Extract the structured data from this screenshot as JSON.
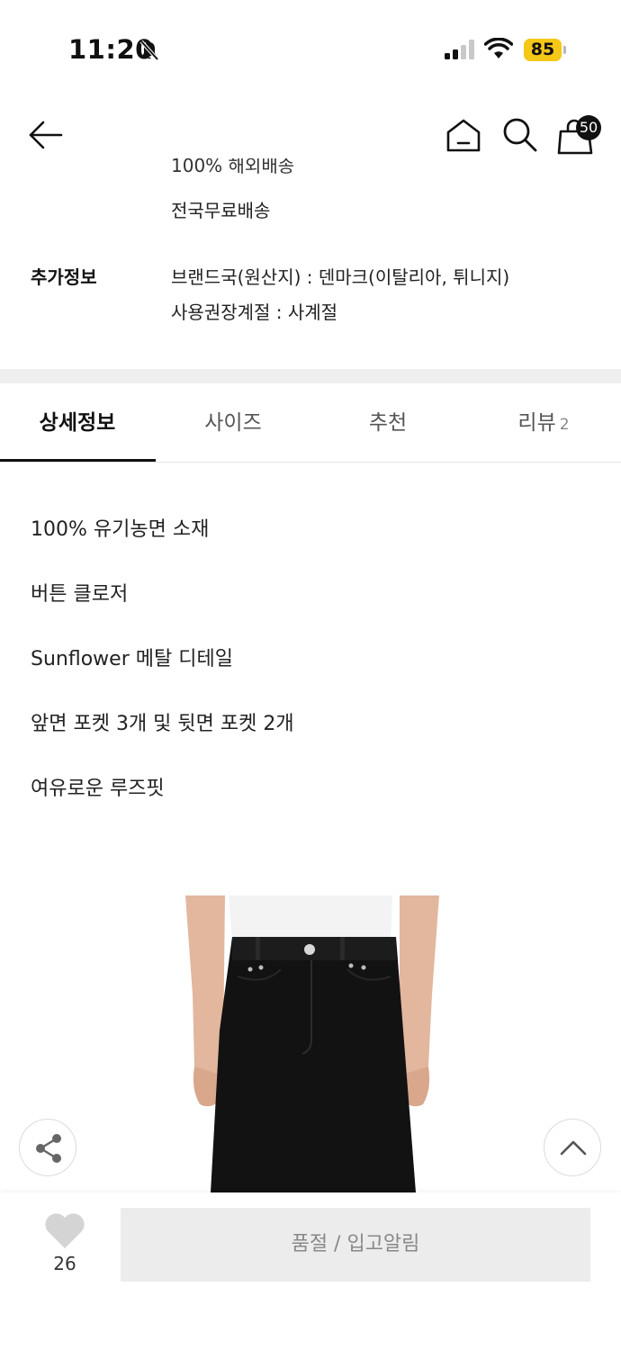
{
  "status_bar": {
    "time": "11:20",
    "battery": "85"
  },
  "header": {
    "cart_count": "50"
  },
  "info": {
    "clipped_line": "100% 해외배송",
    "shipping_line": "전국무료배송",
    "extra_label": "추가정보",
    "extra_lines": [
      "브랜드국(원산지) : 덴마크(이탈리아, 튀니지)",
      "사용권장계절 : 사계절"
    ]
  },
  "tabs": [
    {
      "label": "상세정보",
      "active": true
    },
    {
      "label": "사이즈",
      "active": false
    },
    {
      "label": "추천",
      "active": false
    },
    {
      "label": "리뷰",
      "count": "2",
      "active": false
    }
  ],
  "details": [
    "100% 유기농면 소재",
    "버튼 클로저",
    "Sunflower 메탈 디테일",
    "앞면 포켓 3개 및 뒷면 포켓 2개",
    "여유로운 루즈핏"
  ],
  "bottom_bar": {
    "like_count": "26",
    "soldout_label": "품절 / 입고알림"
  },
  "colors": {
    "accent": "#111111",
    "battery": "#f5c818",
    "disabled_button": "#ececec"
  },
  "icons": [
    "bell-off-icon",
    "signal-icon",
    "wifi-icon",
    "back-arrow-icon",
    "home-icon",
    "search-icon",
    "cart-icon",
    "share-icon",
    "chevron-up-icon",
    "heart-icon"
  ]
}
